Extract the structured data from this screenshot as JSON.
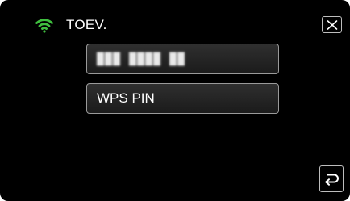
{
  "header": {
    "icon": "wifi-icon",
    "icon_color": "#3fbf3f",
    "title": "TOEV."
  },
  "toolbar": {
    "close_icon": "close-icon",
    "back_icon": "return-icon"
  },
  "menu": {
    "items": [
      {
        "label": "███ ████ ██",
        "obscured": true
      },
      {
        "label": "WPS PIN"
      }
    ]
  }
}
